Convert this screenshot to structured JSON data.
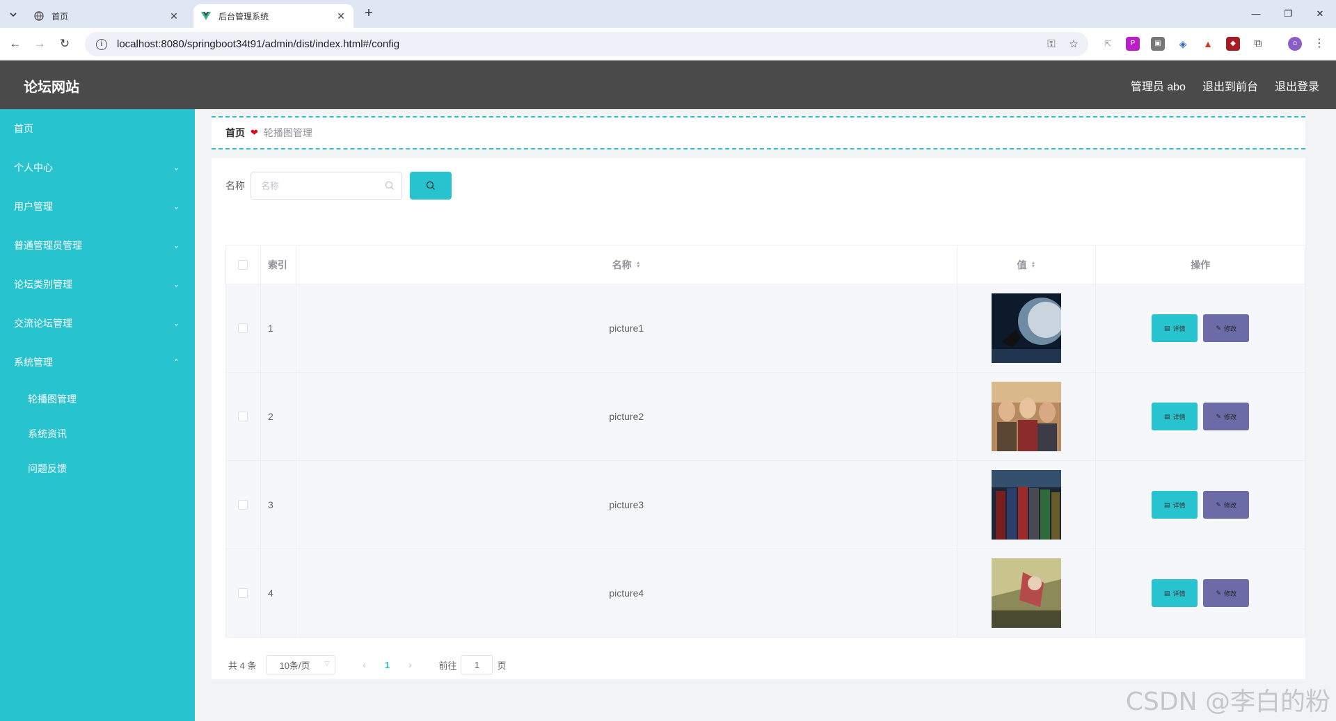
{
  "browser": {
    "tabs": [
      {
        "title": "首页"
      },
      {
        "title": "后台管理系统"
      }
    ],
    "url": "localhost:8080/springboot34t91/admin/dist/index.html#/config"
  },
  "header": {
    "title": "论坛网站",
    "user_label": "管理员 abo",
    "to_front": "退出到前台",
    "logout": "退出登录"
  },
  "sidebar": {
    "items": [
      {
        "label": "首页"
      },
      {
        "label": "个人中心"
      },
      {
        "label": "用户管理"
      },
      {
        "label": "普通管理员管理"
      },
      {
        "label": "论坛类别管理"
      },
      {
        "label": "交流论坛管理"
      },
      {
        "label": "系统管理"
      }
    ],
    "sub_items": [
      {
        "label": "轮播图管理"
      },
      {
        "label": "系统资讯"
      },
      {
        "label": "问题反馈"
      }
    ]
  },
  "breadcrumb": {
    "home": "首页",
    "separator": "❤",
    "current": "轮播图管理"
  },
  "search": {
    "label": "名称",
    "placeholder": "名称"
  },
  "table": {
    "headers": {
      "index": "索引",
      "name": "名称",
      "value": "值",
      "ops": "操作"
    },
    "rows": [
      {
        "index": "1",
        "name": "picture1"
      },
      {
        "index": "2",
        "name": "picture2"
      },
      {
        "index": "3",
        "name": "picture3"
      },
      {
        "index": "4",
        "name": "picture4"
      }
    ],
    "detail_label": "详情",
    "edit_label": "修改"
  },
  "pagination": {
    "total": "共 4 条",
    "page_size": "10条/页",
    "current_page": "1",
    "goto_label": "前往",
    "goto_value": "1",
    "page_suffix": "页"
  },
  "watermark": "CSDN @李白的粉",
  "colors": {
    "accent": "#27c3cf",
    "header_bg": "#4a4a4a",
    "edit_button": "#6b6ba8"
  }
}
